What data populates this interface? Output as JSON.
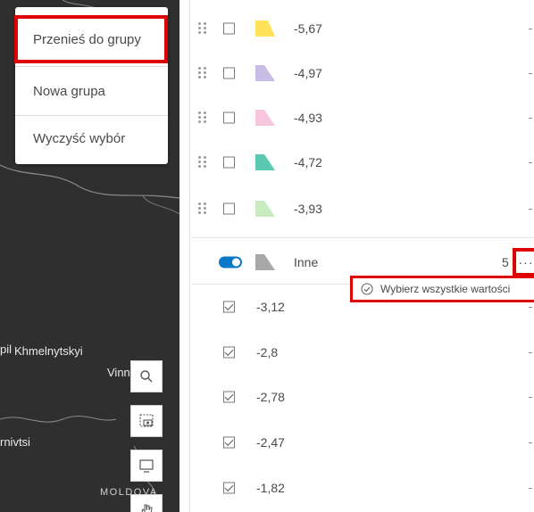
{
  "context_menu": {
    "items": [
      {
        "label": "Przenieś do grupy"
      },
      {
        "label": "Nowa grupa"
      },
      {
        "label": "Wyczyść wybór"
      }
    ]
  },
  "map": {
    "labels": [
      "pil",
      "Khmelnytskyi",
      "Vinn",
      "rnivtsi",
      "MOLDOVA"
    ],
    "tools": [
      "search-icon",
      "screen-capture-icon",
      "present-icon",
      "pan-icon"
    ]
  },
  "unique_values": [
    {
      "value": "-5,67",
      "color": "#ffe15a"
    },
    {
      "value": "-4,97",
      "color": "#c7bde6"
    },
    {
      "value": "-4,93",
      "color": "#f7c6dc"
    },
    {
      "value": "-4,72",
      "color": "#5bc8b2"
    },
    {
      "value": "-3,93",
      "color": "#c8ebc0"
    }
  ],
  "group": {
    "label": "Inne",
    "count": "5",
    "toggle_on": true,
    "swatch_color": "#a8a8a8",
    "more_label": "···",
    "tooltip": "Wybierz wszystkie wartości"
  },
  "other_values": [
    {
      "value": "-3,12",
      "checked": true
    },
    {
      "value": "-2,8",
      "checked": true
    },
    {
      "value": "-2,78",
      "checked": true
    },
    {
      "value": "-2,47",
      "checked": true
    },
    {
      "value": "-1,82",
      "checked": true
    }
  ],
  "colors": {
    "highlight": "#e00000",
    "toggle": "#0a78c8"
  }
}
